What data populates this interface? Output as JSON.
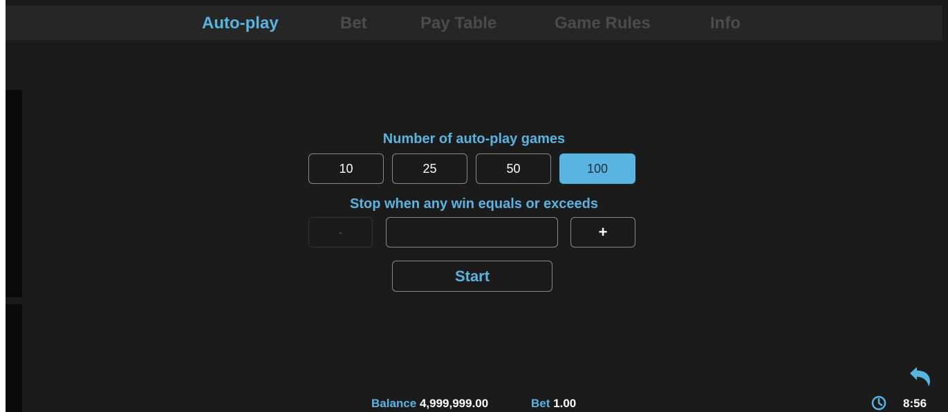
{
  "tabs": [
    {
      "label": "Auto-play",
      "active": true
    },
    {
      "label": "Bet",
      "active": false
    },
    {
      "label": "Pay Table",
      "active": false
    },
    {
      "label": "Game Rules",
      "active": false
    },
    {
      "label": "Info",
      "active": false
    }
  ],
  "autoplay": {
    "games_title": "Number of auto-play games",
    "options": [
      "10",
      "25",
      "50",
      "100"
    ],
    "selected": "100",
    "stop_title": "Stop when any win equals or exceeds",
    "minus_label": "-",
    "plus_label": "+",
    "stop_value": "",
    "start_label": "Start"
  },
  "status": {
    "balance_label": "Balance",
    "balance_value": "4,999,999.00",
    "bet_label": "Bet",
    "bet_value": "1.00"
  },
  "clock": {
    "time": "8:56"
  },
  "icons": {
    "back": "undo-arrow-icon",
    "clock": "clock-icon"
  },
  "colors": {
    "accent": "#5ab4e2",
    "background": "#1b1b1b",
    "topbar": "#262626",
    "inactive_tab": "#4b4b4b"
  }
}
